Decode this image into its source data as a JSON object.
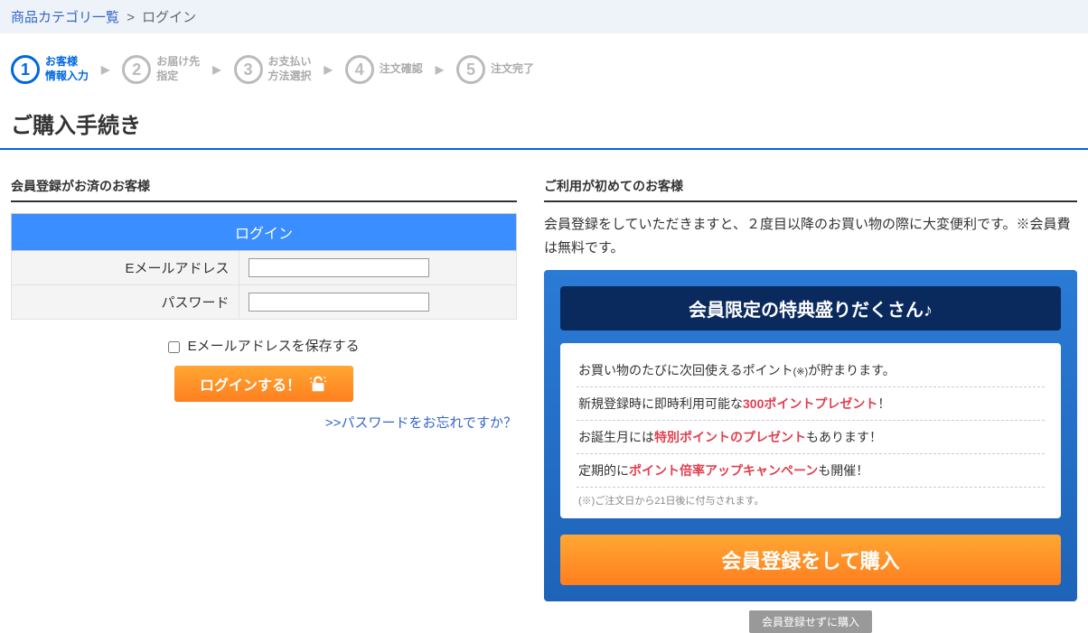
{
  "breadcrumb": {
    "link": "商品カテゴリ一覧",
    "sep": ">",
    "current": "ログイン"
  },
  "steps": [
    {
      "num": "1",
      "label": "お客様\n情報入力",
      "active": true
    },
    {
      "num": "2",
      "label": "お届け先\n指定",
      "active": false
    },
    {
      "num": "3",
      "label": "お支払い\n方法選択",
      "active": false
    },
    {
      "num": "4",
      "label": "注文確認",
      "active": false
    },
    {
      "num": "5",
      "label": "注文完了",
      "active": false
    }
  ],
  "page_title": "ご購入手続き",
  "login": {
    "section_heading": "会員登録がお済のお客様",
    "header": "ログイン",
    "email_label": "Eメールアドレス",
    "password_label": "パスワード",
    "save_email_label": "Eメールアドレスを保存する",
    "submit_label": "ログインする！",
    "forgot_link": ">>パスワードをお忘れですか？"
  },
  "newuser": {
    "section_heading": "ご利用が初めてのお客様",
    "intro": "会員登録をしていただきますと、２度目以降のお買い物の際に大変便利です。※会員費は無料です。",
    "promo_header": "会員限定の特典盛りだくさん♪",
    "promo_items": {
      "p1a": "お買い物のたびに次回使えるポイント",
      "p1b": "(※)",
      "p1c": "が貯まります。",
      "p2a": "新規登録時に即時利用可能な",
      "p2b": "300ポイントプレゼント",
      "p2c": "！",
      "p3a": "お誕生月には",
      "p3b": "特別ポイントのプレゼント",
      "p3c": "もあります！",
      "p4a": "定期的に",
      "p4b": "ポイント倍率アップキャンペーン",
      "p4c": "も開催！"
    },
    "promo_note": "(※)ご注文日から21日後に付与されます。",
    "register_label": "会員登録をして購入",
    "guest_label": "会員登録せずに購入"
  }
}
